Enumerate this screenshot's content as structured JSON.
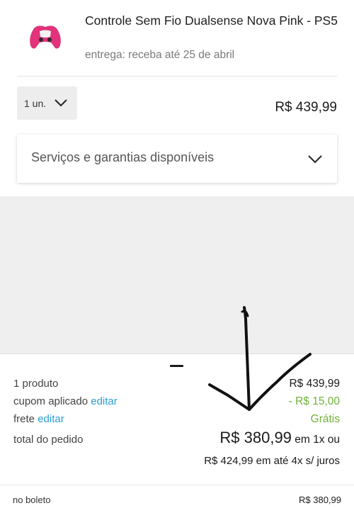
{
  "product": {
    "title": "Controle Sem Fio Dualsense Nova Pink - PS5",
    "delivery": "entrega: receba até 25 de abril",
    "quantity": "1 un.",
    "price": "R$ 439,99",
    "thumb_color": "#e0337a"
  },
  "services": {
    "label": "Serviços e garantias disponíveis"
  },
  "summary": {
    "products_label": "1 produto",
    "products_value": "R$ 439,99",
    "coupon_label": "cupom aplicado",
    "coupon_edit": "editar",
    "coupon_value": "- R$ 15,00",
    "shipping_label": "frete",
    "shipping_edit": "editar",
    "shipping_value": "Grátis",
    "total_label": "total do pedido",
    "total_value": "R$ 380,99",
    "total_suffix": "em 1x ou",
    "installments": "R$ 424,99 em até 4x s/ juros",
    "boleto_label": "no boleto",
    "boleto_value": "R$ 380,99"
  },
  "colors": {
    "link": "#2a9fd6",
    "discount_green": "#6fb13a",
    "background": "#efefef"
  }
}
